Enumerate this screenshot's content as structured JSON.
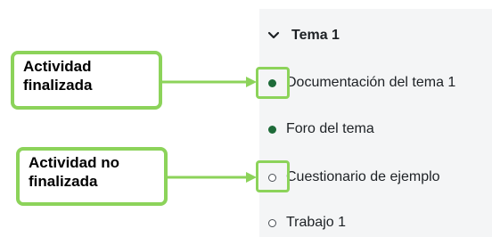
{
  "section": {
    "title": "Tema 1",
    "collapse_icon": "chevron-down-icon"
  },
  "activities": [
    {
      "label": "Documentación del tema 1",
      "status": "completed"
    },
    {
      "label": "Foro del tema",
      "status": "completed"
    },
    {
      "label": "Cuestionario de ejemplo",
      "status": "not-completed"
    },
    {
      "label": "Trabajo 1",
      "status": "not-completed"
    }
  ],
  "callouts": {
    "completed": {
      "line1": "Actividad",
      "line2": "finalizada"
    },
    "not_completed": {
      "line1": "Actividad no",
      "line2": "finalizada"
    }
  },
  "colors": {
    "highlight": "#8cd35a",
    "completed_dot": "#1e6b39",
    "panel_bg": "#f4f5f6"
  }
}
